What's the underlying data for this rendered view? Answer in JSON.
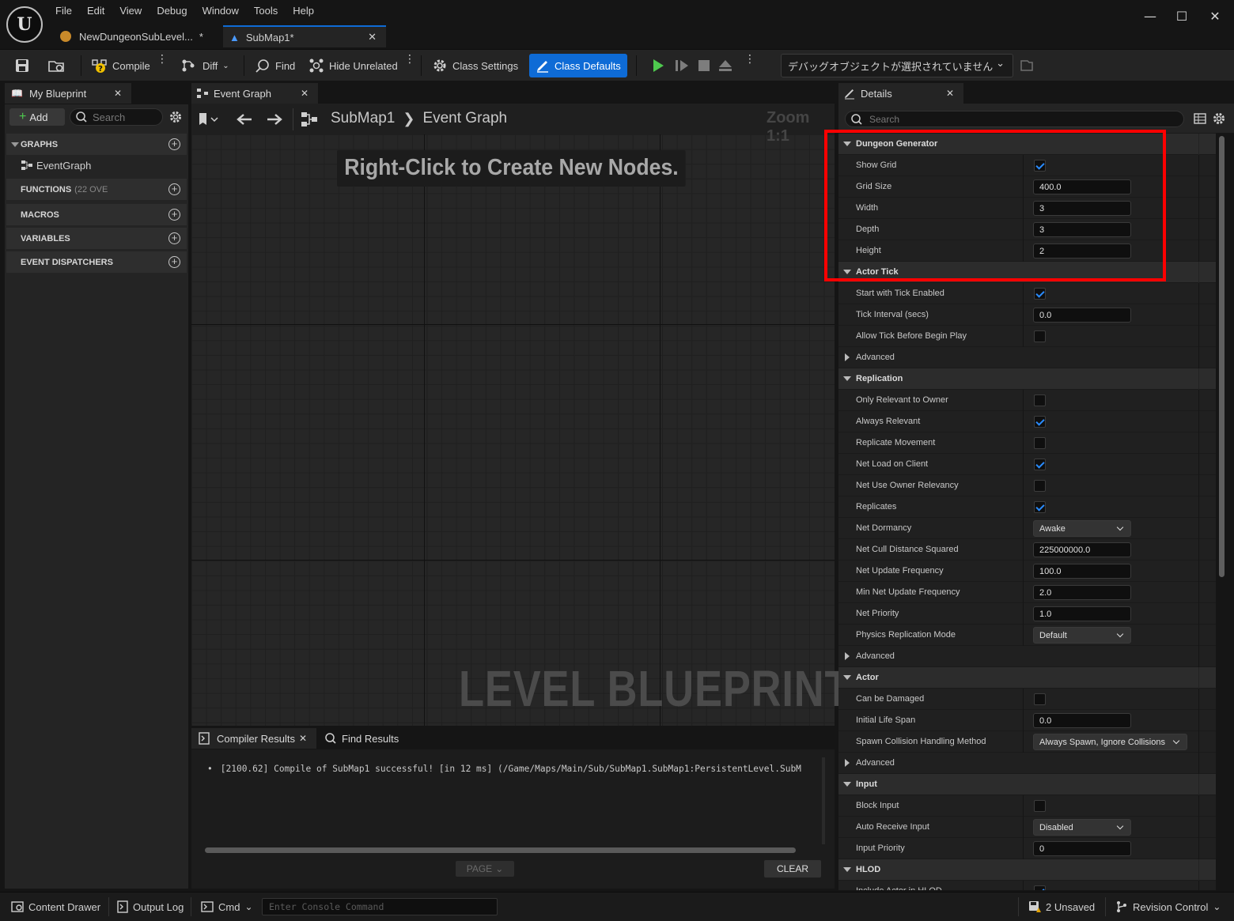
{
  "menu": [
    "File",
    "Edit",
    "View",
    "Debug",
    "Window",
    "Tools",
    "Help"
  ],
  "doc_tabs": [
    {
      "label": "NewDungeonSubLevel...",
      "marker": "*"
    },
    {
      "label": "SubMap1*"
    }
  ],
  "toolbar": {
    "compile": "Compile",
    "diff": "Diff",
    "find": "Find",
    "hide_unrelated": "Hide Unrelated",
    "class_settings": "Class Settings",
    "class_defaults": "Class Defaults",
    "debug_object": "デバッグオブジェクトが選択されていません"
  },
  "my_blueprint": {
    "tab": "My Blueprint",
    "add": "Add",
    "search_placeholder": "Search",
    "sections": {
      "graphs": "GRAPHS",
      "functions": "FUNCTIONS",
      "functions_count": "(22 OVE",
      "macros": "MACROS",
      "variables": "VARIABLES",
      "dispatchers": "EVENT DISPATCHERS"
    },
    "graph_item": "EventGraph"
  },
  "graph": {
    "tab": "Event Graph",
    "breadcrumb_root": "SubMap1",
    "breadcrumb_leaf": "Event Graph",
    "zoom": "Zoom 1:1",
    "hint": "Right-Click to Create New Nodes.",
    "watermark": "LEVEL BLUEPRINT"
  },
  "compiler": {
    "tab": "Compiler Results",
    "find_tab": "Find Results",
    "message": "[2100.62] Compile of SubMap1 successful! [in 12 ms] (/Game/Maps/Main/Sub/SubMap1.SubMap1:PersistentLevel.SubM",
    "page": "PAGE",
    "clear": "CLEAR"
  },
  "details": {
    "tab": "Details",
    "search_placeholder": "Search",
    "rows": [
      {
        "type": "cat",
        "label": "Dungeon Generator"
      },
      {
        "type": "check",
        "label": "Show Grid",
        "value": true
      },
      {
        "type": "num",
        "label": "Grid Size",
        "value": "400.0"
      },
      {
        "type": "num",
        "label": "Width",
        "value": "3"
      },
      {
        "type": "num",
        "label": "Depth",
        "value": "3"
      },
      {
        "type": "num",
        "label": "Height",
        "value": "2"
      },
      {
        "type": "cat",
        "label": "Actor Tick"
      },
      {
        "type": "check",
        "label": "Start with Tick Enabled",
        "value": true
      },
      {
        "type": "num",
        "label": "Tick Interval (secs)",
        "value": "0.0"
      },
      {
        "type": "check",
        "label": "Allow Tick Before Begin Play",
        "value": false
      },
      {
        "type": "adv",
        "label": "Advanced"
      },
      {
        "type": "cat",
        "label": "Replication"
      },
      {
        "type": "check",
        "label": "Only Relevant to Owner",
        "value": false
      },
      {
        "type": "check",
        "label": "Always Relevant",
        "value": true
      },
      {
        "type": "check",
        "label": "Replicate Movement",
        "value": false
      },
      {
        "type": "check",
        "label": "Net Load on Client",
        "value": true
      },
      {
        "type": "check",
        "label": "Net Use Owner Relevancy",
        "value": false
      },
      {
        "type": "check",
        "label": "Replicates",
        "value": true
      },
      {
        "type": "dd",
        "label": "Net Dormancy",
        "value": "Awake"
      },
      {
        "type": "num",
        "label": "Net Cull Distance Squared",
        "value": "225000000.0"
      },
      {
        "type": "num",
        "label": "Net Update Frequency",
        "value": "100.0"
      },
      {
        "type": "num",
        "label": "Min Net Update Frequency",
        "value": "2.0"
      },
      {
        "type": "num",
        "label": "Net Priority",
        "value": "1.0"
      },
      {
        "type": "dd",
        "label": "Physics Replication Mode",
        "value": "Default"
      },
      {
        "type": "adv",
        "label": "Advanced"
      },
      {
        "type": "cat",
        "label": "Actor"
      },
      {
        "type": "check",
        "label": "Can be Damaged",
        "value": false
      },
      {
        "type": "num",
        "label": "Initial Life Span",
        "value": "0.0"
      },
      {
        "type": "dd-wide",
        "label": "Spawn Collision Handling Method",
        "value": "Always Spawn, Ignore Collisions"
      },
      {
        "type": "adv",
        "label": "Advanced"
      },
      {
        "type": "cat",
        "label": "Input"
      },
      {
        "type": "check",
        "label": "Block Input",
        "value": false
      },
      {
        "type": "dd",
        "label": "Auto Receive Input",
        "value": "Disabled"
      },
      {
        "type": "num",
        "label": "Input Priority",
        "value": "0"
      },
      {
        "type": "cat",
        "label": "HLOD"
      },
      {
        "type": "check",
        "label": "Include Actor in HLOD",
        "value": true
      }
    ]
  },
  "statusbar": {
    "content_drawer": "Content Drawer",
    "output_log": "Output Log",
    "cmd": "Cmd",
    "console_placeholder": "Enter Console Command",
    "unsaved": "2 Unsaved",
    "revision": "Revision Control"
  },
  "colors": {
    "accent": "#0e6bd6",
    "highlight_box": "#ff0000",
    "play_green": "#4ec94e"
  }
}
